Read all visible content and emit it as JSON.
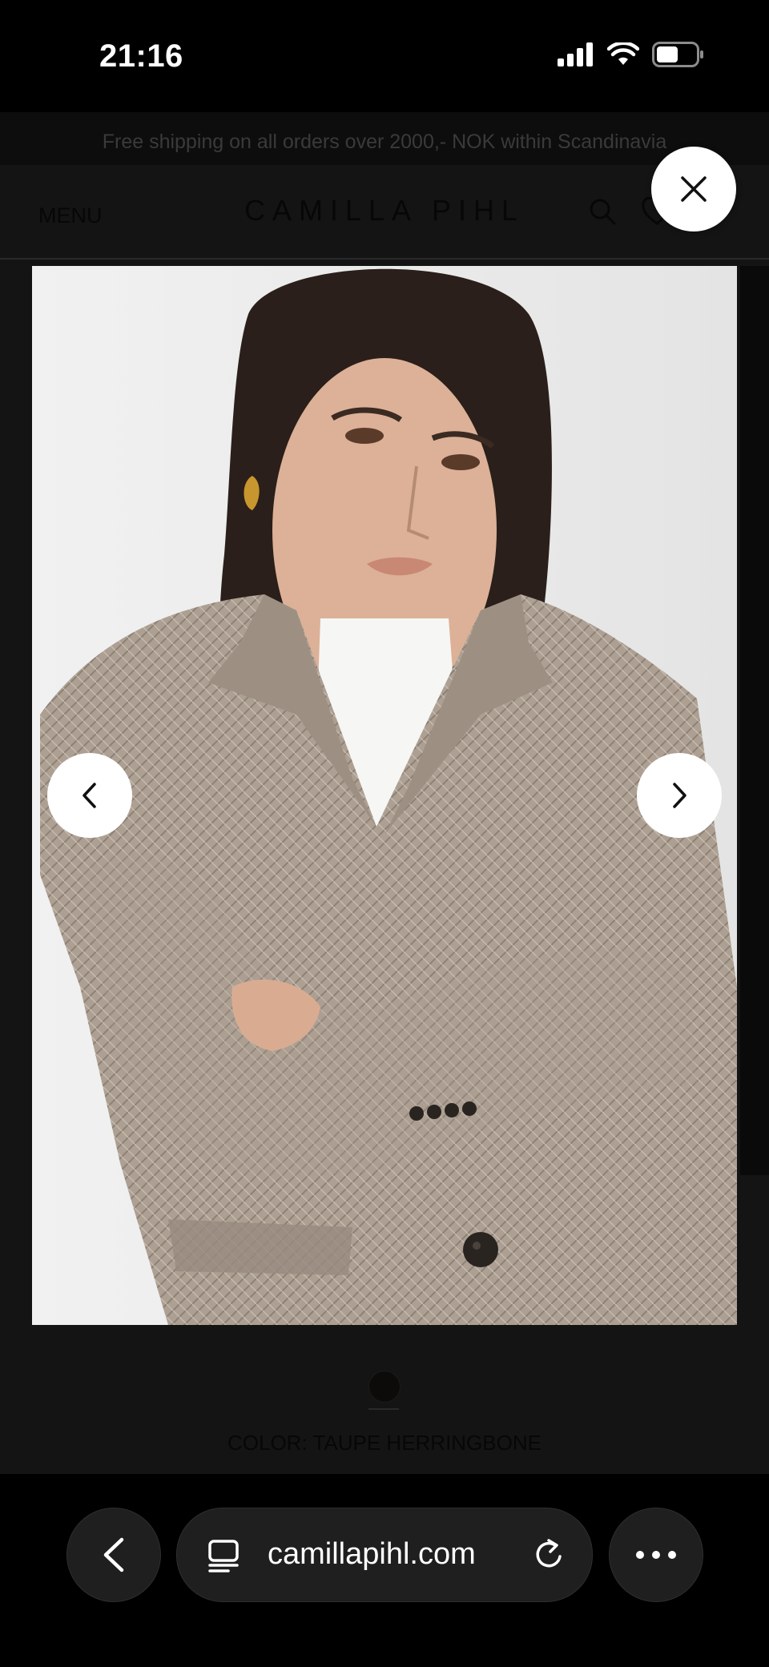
{
  "status_bar": {
    "time": "21:16",
    "icons": [
      "cellular-signal-icon",
      "wifi-icon",
      "battery-icon"
    ]
  },
  "page": {
    "promo_text": "Free shipping on all orders over 2000,- NOK within Scandinavia",
    "header": {
      "menu_label": "MENU",
      "brand": "CAMILLA PIHL",
      "icons": [
        "search-icon",
        "heart-icon"
      ]
    },
    "product": {
      "color_label": "COLOR: TAUPE HERRINGBONE",
      "swatch_color": "#0d0b09"
    }
  },
  "lightbox": {
    "icons": [
      "close-icon",
      "chevron-left-icon",
      "chevron-right-icon"
    ]
  },
  "browser": {
    "url": "camillapihl.com",
    "icons": [
      "back-chevron-icon",
      "tabs-icon",
      "reload-icon",
      "more-icon"
    ]
  },
  "colors": {
    "overlay_bg": "#141414",
    "button_bg": "#ffffff",
    "toolbar_button_bg": "#1f1f1f"
  }
}
